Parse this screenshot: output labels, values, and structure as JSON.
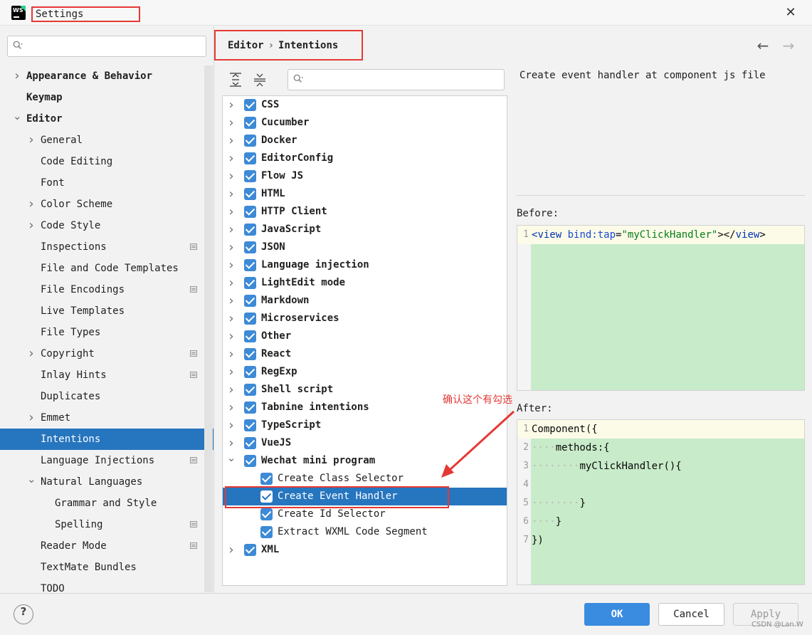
{
  "window": {
    "title": "Settings",
    "close_glyph": "✕",
    "logo_text": "WS"
  },
  "sidebar": {
    "search_placeholder": "",
    "items": [
      {
        "label": "Appearance & Behavior",
        "bold": true,
        "expandable": true,
        "expanded": false,
        "level": 0,
        "managed": false,
        "selected": false
      },
      {
        "label": "Keymap",
        "bold": true,
        "expandable": false,
        "expanded": false,
        "level": 0,
        "managed": false,
        "selected": false
      },
      {
        "label": "Editor",
        "bold": true,
        "expandable": true,
        "expanded": true,
        "level": 0,
        "managed": false,
        "selected": false
      },
      {
        "label": "General",
        "bold": false,
        "expandable": true,
        "expanded": false,
        "level": 1,
        "managed": false,
        "selected": false
      },
      {
        "label": "Code Editing",
        "bold": false,
        "expandable": false,
        "expanded": false,
        "level": 1,
        "managed": false,
        "selected": false
      },
      {
        "label": "Font",
        "bold": false,
        "expandable": false,
        "expanded": false,
        "level": 1,
        "managed": false,
        "selected": false
      },
      {
        "label": "Color Scheme",
        "bold": false,
        "expandable": true,
        "expanded": false,
        "level": 1,
        "managed": false,
        "selected": false
      },
      {
        "label": "Code Style",
        "bold": false,
        "expandable": true,
        "expanded": false,
        "level": 1,
        "managed": false,
        "selected": false
      },
      {
        "label": "Inspections",
        "bold": false,
        "expandable": false,
        "expanded": false,
        "level": 1,
        "managed": true,
        "selected": false
      },
      {
        "label": "File and Code Templates",
        "bold": false,
        "expandable": false,
        "expanded": false,
        "level": 1,
        "managed": false,
        "selected": false
      },
      {
        "label": "File Encodings",
        "bold": false,
        "expandable": false,
        "expanded": false,
        "level": 1,
        "managed": true,
        "selected": false
      },
      {
        "label": "Live Templates",
        "bold": false,
        "expandable": false,
        "expanded": false,
        "level": 1,
        "managed": false,
        "selected": false
      },
      {
        "label": "File Types",
        "bold": false,
        "expandable": false,
        "expanded": false,
        "level": 1,
        "managed": false,
        "selected": false
      },
      {
        "label": "Copyright",
        "bold": false,
        "expandable": true,
        "expanded": false,
        "level": 1,
        "managed": true,
        "selected": false
      },
      {
        "label": "Inlay Hints",
        "bold": false,
        "expandable": false,
        "expanded": false,
        "level": 1,
        "managed": true,
        "selected": false
      },
      {
        "label": "Duplicates",
        "bold": false,
        "expandable": false,
        "expanded": false,
        "level": 1,
        "managed": false,
        "selected": false
      },
      {
        "label": "Emmet",
        "bold": false,
        "expandable": true,
        "expanded": false,
        "level": 1,
        "managed": false,
        "selected": false
      },
      {
        "label": "Intentions",
        "bold": false,
        "expandable": false,
        "expanded": false,
        "level": 1,
        "managed": false,
        "selected": true
      },
      {
        "label": "Language Injections",
        "bold": false,
        "expandable": false,
        "expanded": false,
        "level": 1,
        "managed": true,
        "selected": false
      },
      {
        "label": "Natural Languages",
        "bold": false,
        "expandable": true,
        "expanded": true,
        "level": 1,
        "managed": false,
        "selected": false
      },
      {
        "label": "Grammar and Style",
        "bold": false,
        "expandable": false,
        "expanded": false,
        "level": 2,
        "managed": false,
        "selected": false
      },
      {
        "label": "Spelling",
        "bold": false,
        "expandable": false,
        "expanded": false,
        "level": 2,
        "managed": true,
        "selected": false
      },
      {
        "label": "Reader Mode",
        "bold": false,
        "expandable": false,
        "expanded": false,
        "level": 1,
        "managed": true,
        "selected": false
      },
      {
        "label": "TextMate Bundles",
        "bold": false,
        "expandable": false,
        "expanded": false,
        "level": 1,
        "managed": false,
        "selected": false
      },
      {
        "label": "TODO",
        "bold": false,
        "expandable": false,
        "expanded": false,
        "level": 1,
        "managed": false,
        "selected": false
      }
    ]
  },
  "breadcrumb": {
    "parent": "Editor",
    "separator": "›",
    "current": "Intentions"
  },
  "nav": {
    "back_glyph": "←",
    "forward_glyph": "→"
  },
  "toolbar": {
    "search_placeholder": ""
  },
  "intentions": [
    {
      "label": "CSS",
      "level": 0,
      "expandable": true,
      "expanded": false,
      "checked": true,
      "selected": false
    },
    {
      "label": "Cucumber",
      "level": 0,
      "expandable": true,
      "expanded": false,
      "checked": true,
      "selected": false
    },
    {
      "label": "Docker",
      "level": 0,
      "expandable": true,
      "expanded": false,
      "checked": true,
      "selected": false
    },
    {
      "label": "EditorConfig",
      "level": 0,
      "expandable": true,
      "expanded": false,
      "checked": true,
      "selected": false
    },
    {
      "label": "Flow JS",
      "level": 0,
      "expandable": true,
      "expanded": false,
      "checked": true,
      "selected": false
    },
    {
      "label": "HTML",
      "level": 0,
      "expandable": true,
      "expanded": false,
      "checked": true,
      "selected": false
    },
    {
      "label": "HTTP Client",
      "level": 0,
      "expandable": true,
      "expanded": false,
      "checked": true,
      "selected": false
    },
    {
      "label": "JavaScript",
      "level": 0,
      "expandable": true,
      "expanded": false,
      "checked": true,
      "selected": false
    },
    {
      "label": "JSON",
      "level": 0,
      "expandable": true,
      "expanded": false,
      "checked": true,
      "selected": false
    },
    {
      "label": "Language injection",
      "level": 0,
      "expandable": true,
      "expanded": false,
      "checked": true,
      "selected": false
    },
    {
      "label": "LightEdit mode",
      "level": 0,
      "expandable": true,
      "expanded": false,
      "checked": true,
      "selected": false
    },
    {
      "label": "Markdown",
      "level": 0,
      "expandable": true,
      "expanded": false,
      "checked": true,
      "selected": false
    },
    {
      "label": "Microservices",
      "level": 0,
      "expandable": true,
      "expanded": false,
      "checked": true,
      "selected": false
    },
    {
      "label": "Other",
      "level": 0,
      "expandable": true,
      "expanded": false,
      "checked": true,
      "selected": false
    },
    {
      "label": "React",
      "level": 0,
      "expandable": true,
      "expanded": false,
      "checked": true,
      "selected": false
    },
    {
      "label": "RegExp",
      "level": 0,
      "expandable": true,
      "expanded": false,
      "checked": true,
      "selected": false
    },
    {
      "label": "Shell script",
      "level": 0,
      "expandable": true,
      "expanded": false,
      "checked": true,
      "selected": false
    },
    {
      "label": "Tabnine intentions",
      "level": 0,
      "expandable": true,
      "expanded": false,
      "checked": true,
      "selected": false
    },
    {
      "label": "TypeScript",
      "level": 0,
      "expandable": true,
      "expanded": false,
      "checked": true,
      "selected": false
    },
    {
      "label": "VueJS",
      "level": 0,
      "expandable": true,
      "expanded": false,
      "checked": true,
      "selected": false
    },
    {
      "label": "Wechat mini program",
      "level": 0,
      "expandable": true,
      "expanded": true,
      "checked": true,
      "selected": false
    },
    {
      "label": "Create Class Selector",
      "level": 1,
      "expandable": false,
      "expanded": false,
      "checked": true,
      "selected": false
    },
    {
      "label": "Create Event Handler",
      "level": 1,
      "expandable": false,
      "expanded": false,
      "checked": true,
      "selected": true
    },
    {
      "label": "Create Id Selector",
      "level": 1,
      "expandable": false,
      "expanded": false,
      "checked": true,
      "selected": false
    },
    {
      "label": "Extract WXML Code Segment",
      "level": 1,
      "expandable": false,
      "expanded": false,
      "checked": true,
      "selected": false
    },
    {
      "label": "XML",
      "level": 0,
      "expandable": true,
      "expanded": false,
      "checked": true,
      "selected": false
    }
  ],
  "annotation": {
    "text": "确认这个有勾选",
    "color": "#e53935"
  },
  "description": "Create event handler at component js file",
  "before": {
    "label": "Before:",
    "lines": [
      {
        "num": "1",
        "tokens": [
          {
            "t": "<",
            "c": "tag"
          },
          {
            "t": "view",
            "c": "tag"
          },
          {
            "t": " ",
            "c": "plain"
          },
          {
            "t": "bind:tap",
            "c": "attr"
          },
          {
            "t": "=",
            "c": "plain"
          },
          {
            "t": "\"myClickHandler\"",
            "c": "str"
          },
          {
            "t": "></",
            "c": "plain"
          },
          {
            "t": "view",
            "c": "tag"
          },
          {
            "t": ">",
            "c": "plain"
          }
        ]
      }
    ]
  },
  "after": {
    "label": "After:",
    "lines": [
      {
        "num": "1",
        "indent": "",
        "code": "Component({"
      },
      {
        "num": "2",
        "indent": "····",
        "code": "methods:{"
      },
      {
        "num": "3",
        "indent": "········",
        "code": "myClickHandler(){"
      },
      {
        "num": "4",
        "indent": "",
        "code": ""
      },
      {
        "num": "5",
        "indent": "········",
        "code": "}"
      },
      {
        "num": "6",
        "indent": "····",
        "code": "}"
      },
      {
        "num": "7",
        "indent": "",
        "code": "})"
      }
    ]
  },
  "footer": {
    "help_glyph": "?",
    "ok_label": "OK",
    "cancel_label": "Cancel",
    "apply_label": "Apply"
  },
  "watermark": "CSDN @Lan.W",
  "colors": {
    "selection": "#2675bf",
    "checkbox": "#3d8ad6",
    "highlight_border": "#e53935",
    "code_bg": "#c8ebc9",
    "primary_button": "#3a8ce0"
  }
}
